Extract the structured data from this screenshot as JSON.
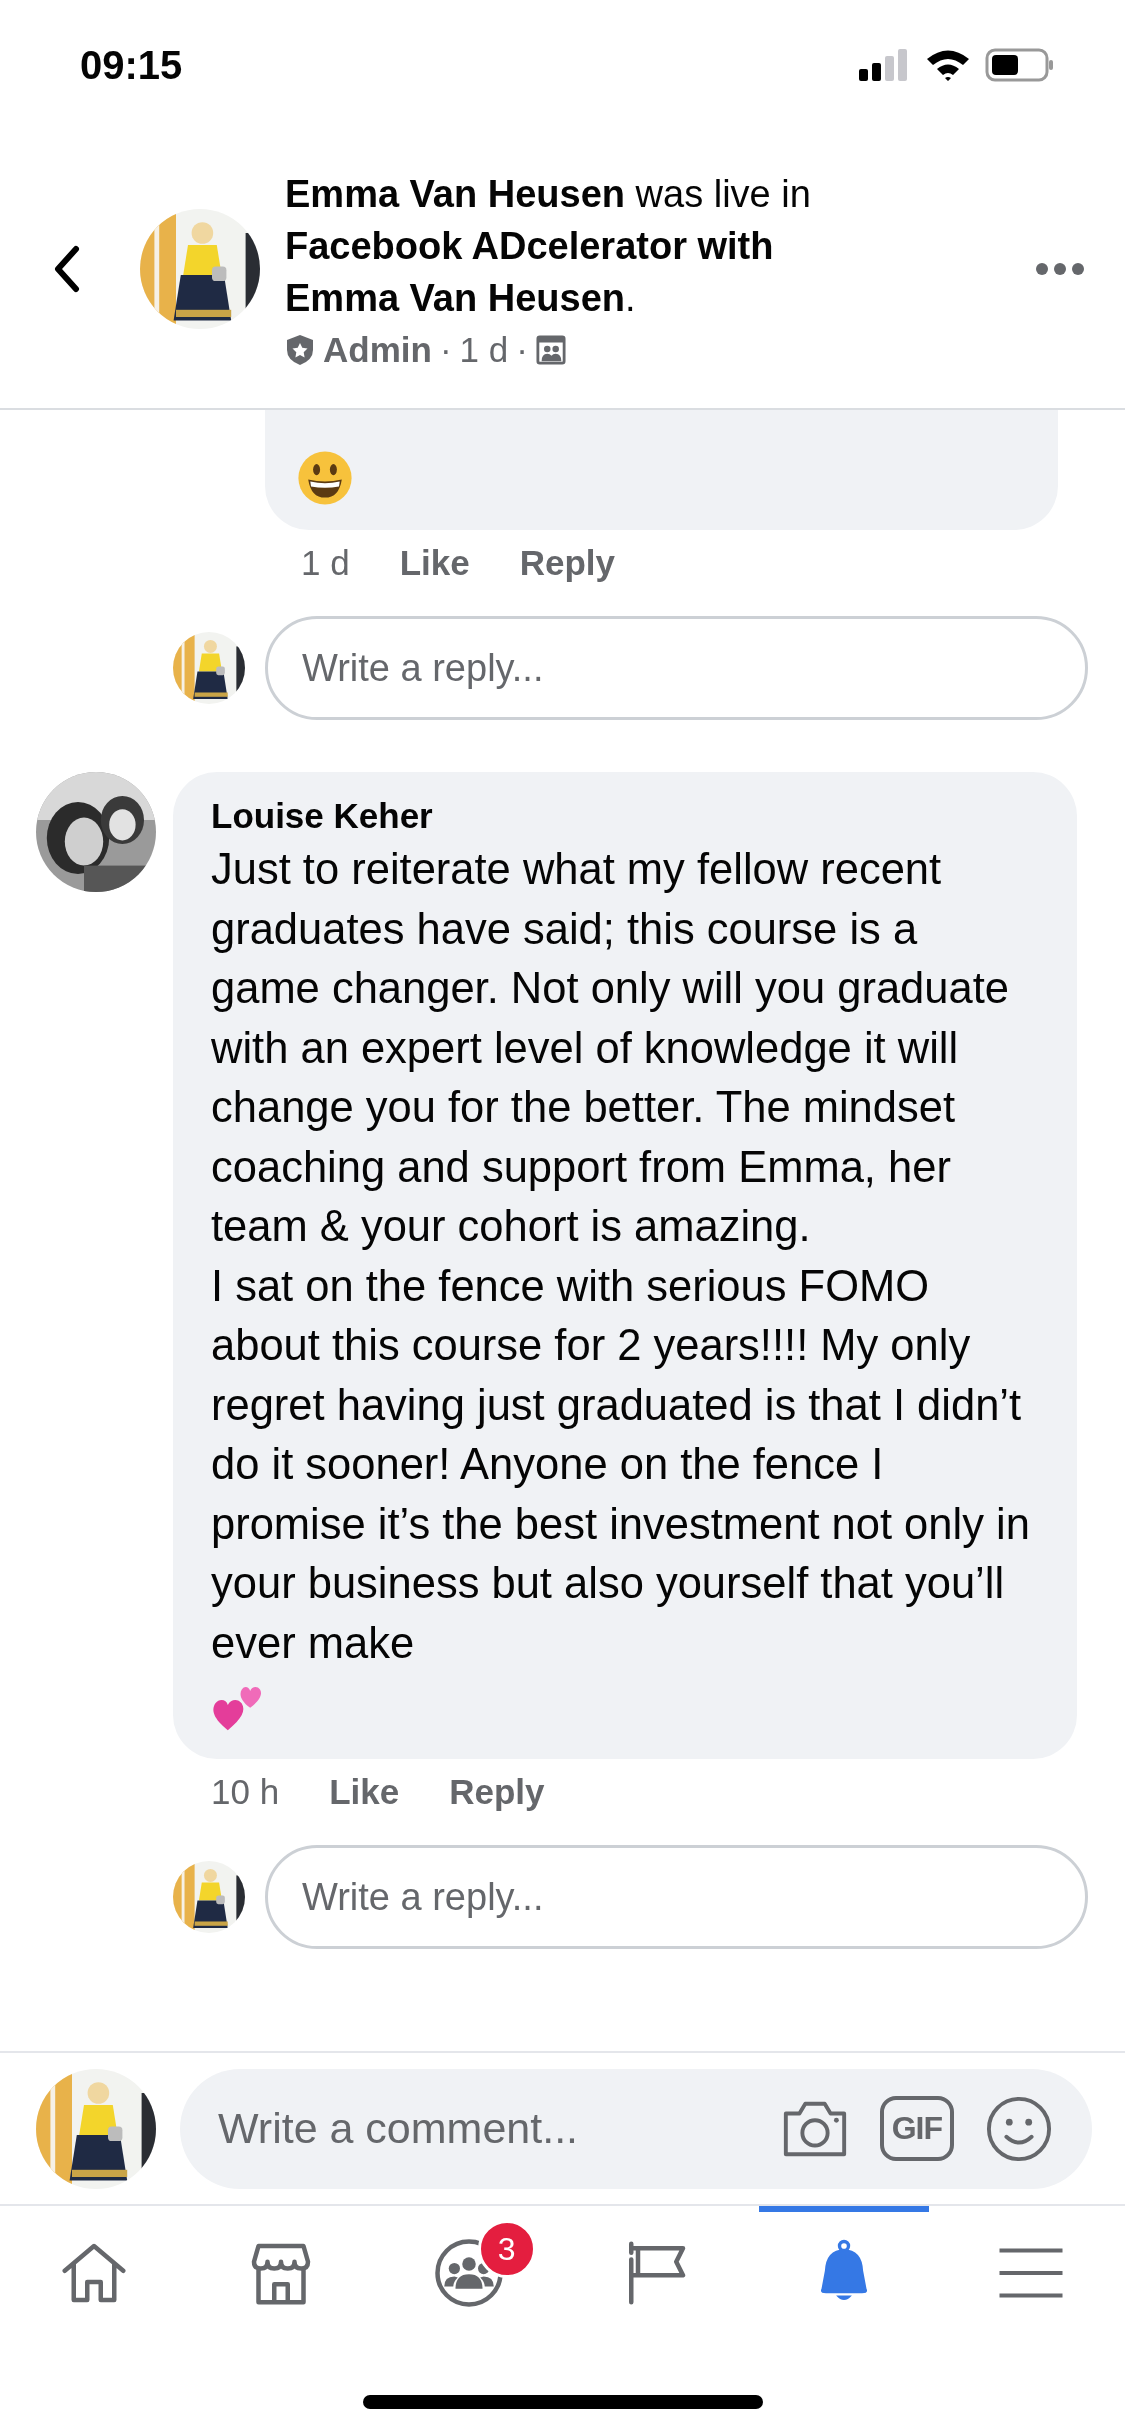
{
  "status_bar": {
    "time": "09:15"
  },
  "header": {
    "title": "**Emma Van Heusen** was live in **Facebook ADcelerator with Emma Van Heusen**.",
    "role": "Admin",
    "separator_1": "·",
    "time": "1 d",
    "separator_2": "·"
  },
  "comments": [
    {
      "kind": "grinning",
      "time": "1 d",
      "like": "Like",
      "reply": "Reply",
      "reply_placeholder": "Write a reply..."
    },
    {
      "kind": "hearts",
      "author": "Louise Keher",
      "paragraphs": [
        "Just to reiterate what my fellow recent graduates have said; this course is a game changer. Not only will you graduate with an expert level of knowledge it will change you for the better. The mindset coaching and support from Emma, her team & your cohort is amazing.",
        "I sat on the fence with serious FOMO about this course for 2 years!!!! My only regret having just graduated is that I didn’t do it sooner! Anyone on the fence I promise it’s the best investment not only in your business but also yourself that you’ll ever make"
      ],
      "time": "10 h",
      "like": "Like",
      "reply": "Reply",
      "reply_placeholder": "Write a reply..."
    }
  ],
  "composer": {
    "placeholder": "Write a comment...",
    "gif_label": "GIF"
  },
  "nav": {
    "tabs": [
      {
        "kind": "home",
        "selected": false
      },
      {
        "kind": "marketplace",
        "selected": false
      },
      {
        "kind": "groups",
        "selected": false,
        "badge": "3"
      },
      {
        "kind": "pages",
        "selected": false
      },
      {
        "kind": "notifications",
        "selected": true
      },
      {
        "kind": "menu",
        "selected": false
      }
    ]
  }
}
